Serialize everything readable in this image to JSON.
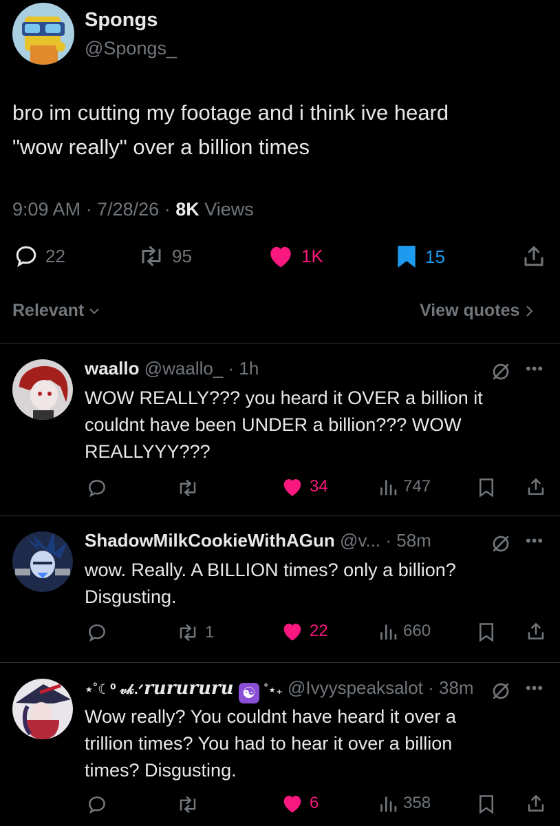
{
  "post": {
    "author_name": "Spongs",
    "author_handle": "@Spongs_",
    "text_line1": "bro im cutting my footage and i think ive heard",
    "text_line2": "\"wow really\" over a billion times",
    "time": "9:09 AM",
    "date": "7/28/26",
    "views_count": "8K",
    "views_label": "Views",
    "replies": "22",
    "reposts": "95",
    "likes": "1K",
    "bookmarks": "15",
    "like_color": "#f91880",
    "bookmark_color": "#1d9bf0"
  },
  "sort": {
    "label": "Relevant",
    "view_quotes": "View quotes"
  },
  "replies": [
    {
      "name": "waallo",
      "handle": "@waallo_",
      "time": "1h",
      "line1": "WOW REALLY??? you heard it OVER a billion it",
      "line2": "couldnt have been UNDER a billion??? WOW",
      "line3": "REALLYYY???",
      "reposts": "",
      "likes": "34",
      "views": "747",
      "liked": true
    },
    {
      "name": "ShadowMilkCookieWithAGun",
      "handle": "@v...",
      "time": "58m",
      "line1": "wow. Really. A BILLION times? only a billion?",
      "line2": "Disgusting.",
      "reposts": "1",
      "likes": "22",
      "views": "660",
      "liked": true
    },
    {
      "name_prefix": "⋆˚☾⁰ 𝓋𝓀.ᐟ",
      "name": "rurururu",
      "name_suffix": "˚⋆₊",
      "handle": "@Ivyyspeaksalot",
      "time": "38m",
      "line1": "Wow really? You couldnt have heard it over a",
      "line2": "trillion times? You had to hear it over a billion",
      "line3": "times? Disgusting.",
      "reposts": "",
      "likes": "6",
      "views": "358",
      "liked": true
    }
  ]
}
